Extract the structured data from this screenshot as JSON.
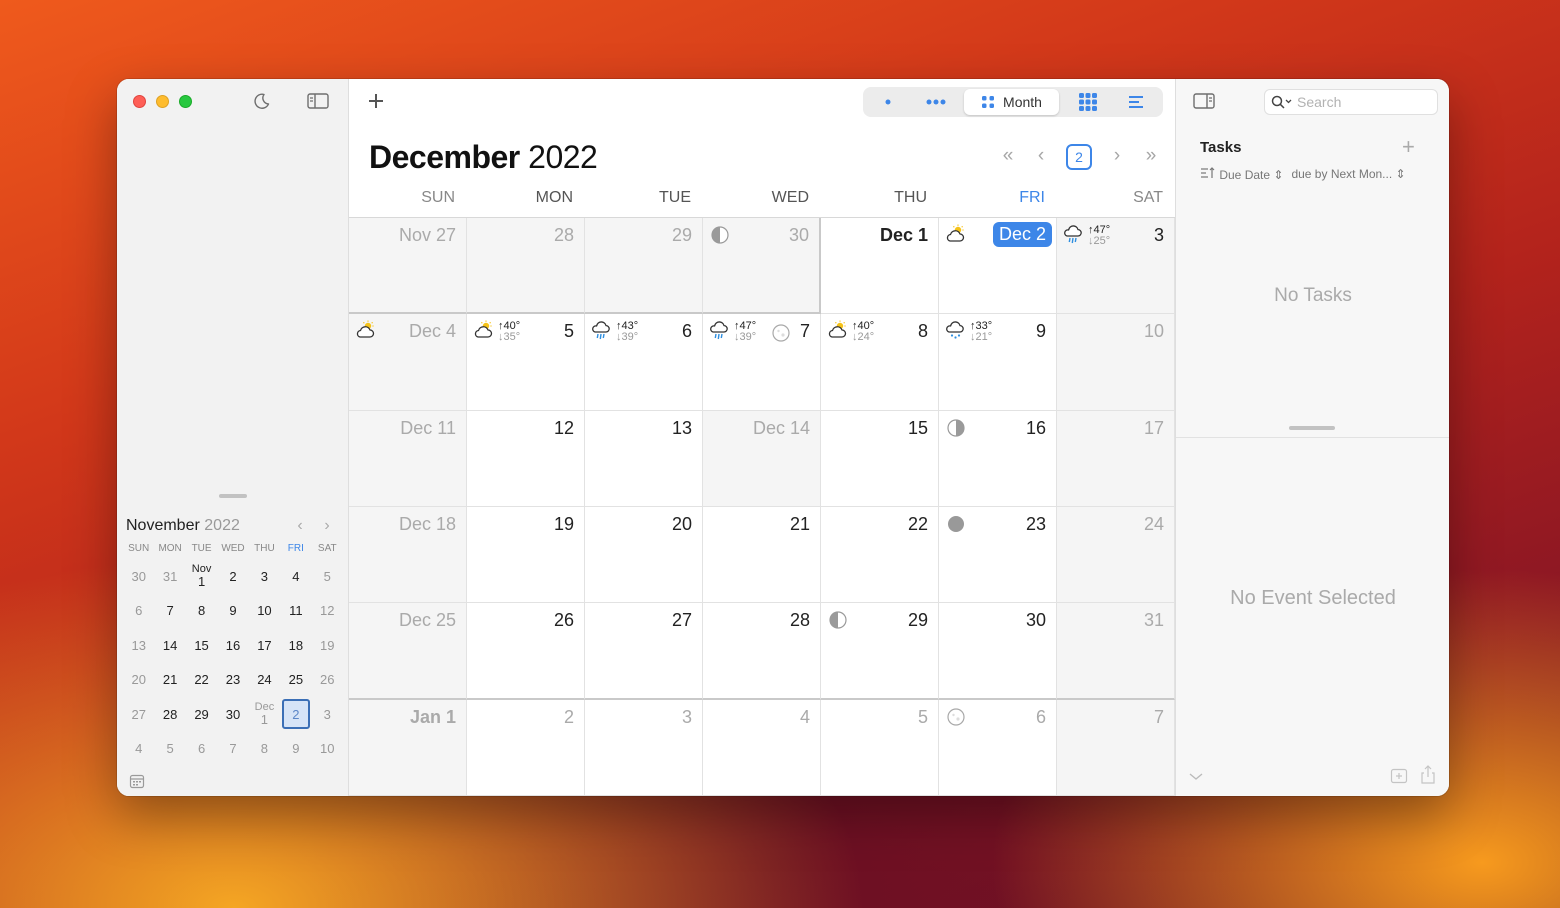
{
  "sidebar": {
    "mini_calendar": {
      "month": "November",
      "year": "2022",
      "prev_label": "‹",
      "next_label": "›",
      "weekdays": [
        "SUN",
        "MON",
        "TUE",
        "WED",
        "THU",
        "FRI",
        "SAT"
      ],
      "weeks": [
        [
          {
            "t": "30",
            "dim": true
          },
          {
            "t": "31",
            "dim": true
          },
          {
            "t": "1",
            "label": "Nov"
          },
          {
            "t": "2"
          },
          {
            "t": "3"
          },
          {
            "t": "4"
          },
          {
            "t": "5",
            "dim": true
          }
        ],
        [
          {
            "t": "6",
            "dim": true
          },
          {
            "t": "7"
          },
          {
            "t": "8"
          },
          {
            "t": "9"
          },
          {
            "t": "10"
          },
          {
            "t": "11"
          },
          {
            "t": "12",
            "dim": true
          }
        ],
        [
          {
            "t": "13",
            "dim": true
          },
          {
            "t": "14"
          },
          {
            "t": "15"
          },
          {
            "t": "16"
          },
          {
            "t": "17"
          },
          {
            "t": "18"
          },
          {
            "t": "19",
            "dim": true
          }
        ],
        [
          {
            "t": "20",
            "dim": true
          },
          {
            "t": "21"
          },
          {
            "t": "22"
          },
          {
            "t": "23"
          },
          {
            "t": "24"
          },
          {
            "t": "25"
          },
          {
            "t": "26",
            "dim": true
          }
        ],
        [
          {
            "t": "27",
            "dim": true
          },
          {
            "t": "28"
          },
          {
            "t": "29"
          },
          {
            "t": "30"
          },
          {
            "t": "1",
            "label": "Dec",
            "dim": true
          },
          {
            "t": "2",
            "sel": true
          },
          {
            "t": "3",
            "dim": true
          }
        ],
        [
          {
            "t": "4",
            "dim": true
          },
          {
            "t": "5",
            "dim": true
          },
          {
            "t": "6",
            "dim": true
          },
          {
            "t": "7",
            "dim": true
          },
          {
            "t": "8",
            "dim": true
          },
          {
            "t": "9",
            "dim": true
          },
          {
            "t": "10",
            "dim": true
          }
        ]
      ]
    }
  },
  "main": {
    "title_month": "December",
    "title_year": "2022",
    "view_month_label": "Month",
    "nav": {
      "prev_prev": "«",
      "prev": "‹",
      "today": "2",
      "next": "›",
      "next_next": "»"
    },
    "weekdays": [
      "SUN",
      "MON",
      "TUE",
      "WED",
      "THU",
      "FRI",
      "SAT"
    ],
    "weeks": [
      [
        {
          "label": "Nov 27",
          "dim": true
        },
        {
          "label": "28",
          "dim": true
        },
        {
          "label": "29",
          "dim": true
        },
        {
          "label": "30",
          "dim": true,
          "moon": "first-quarter"
        },
        {
          "label": "Dec 1",
          "bold": true
        },
        {
          "label": "Dec 2",
          "today": true,
          "wx": "partly-cloudy"
        },
        {
          "label": "3",
          "wx": "rain",
          "hi": "↑47°",
          "lo": "↓25°"
        }
      ],
      [
        {
          "label": "Dec 4",
          "dim": true,
          "wx": "partly-cloudy"
        },
        {
          "label": "5",
          "wx": "partly-cloudy",
          "hi": "↑40°",
          "lo": "↓35°"
        },
        {
          "label": "6",
          "wx": "rain",
          "hi": "↑43°",
          "lo": "↓39°"
        },
        {
          "label": "7",
          "wx": "rain",
          "hi": "↑47°",
          "lo": "↓39°",
          "moon": "full-small"
        },
        {
          "label": "8",
          "wx": "partly-cloudy",
          "hi": "↑40°",
          "lo": "↓24°"
        },
        {
          "label": "9",
          "wx": "snow",
          "hi": "↑33°",
          "lo": "↓21°"
        },
        {
          "label": "10",
          "dim": true
        }
      ],
      [
        {
          "label": "Dec 11",
          "dim": true
        },
        {
          "label": "12"
        },
        {
          "label": "13"
        },
        {
          "label": "Dec 14",
          "dim": true
        },
        {
          "label": "15"
        },
        {
          "label": "16",
          "moon": "last-quarter"
        },
        {
          "label": "17",
          "dim": true
        }
      ],
      [
        {
          "label": "Dec 18",
          "dim": true
        },
        {
          "label": "19"
        },
        {
          "label": "20"
        },
        {
          "label": "21"
        },
        {
          "label": "22"
        },
        {
          "label": "23",
          "moon": "new"
        },
        {
          "label": "24",
          "dim": true
        }
      ],
      [
        {
          "label": "Dec 25",
          "dim": true
        },
        {
          "label": "26"
        },
        {
          "label": "27"
        },
        {
          "label": "28"
        },
        {
          "label": "29",
          "moon": "first-quarter"
        },
        {
          "label": "30"
        },
        {
          "label": "31",
          "dim": true
        }
      ],
      [
        {
          "label": "Jan 1",
          "dim": true,
          "bold": true
        },
        {
          "label": "2",
          "dim": true
        },
        {
          "label": "3",
          "dim": true
        },
        {
          "label": "4",
          "dim": true
        },
        {
          "label": "5",
          "dim": true
        },
        {
          "label": "6",
          "dim": true,
          "moon": "full"
        },
        {
          "label": "7",
          "dim": true
        }
      ]
    ]
  },
  "right_panel": {
    "search_placeholder": "Search",
    "tasks_title": "Tasks",
    "tasks_add": "+",
    "sort_label": "Due Date",
    "filter_label": "due by Next Mon...",
    "no_tasks": "No Tasks",
    "no_event": "No Event Selected"
  },
  "colors": {
    "accent": "#3d86e8",
    "today_bg": "#3d86e8"
  }
}
